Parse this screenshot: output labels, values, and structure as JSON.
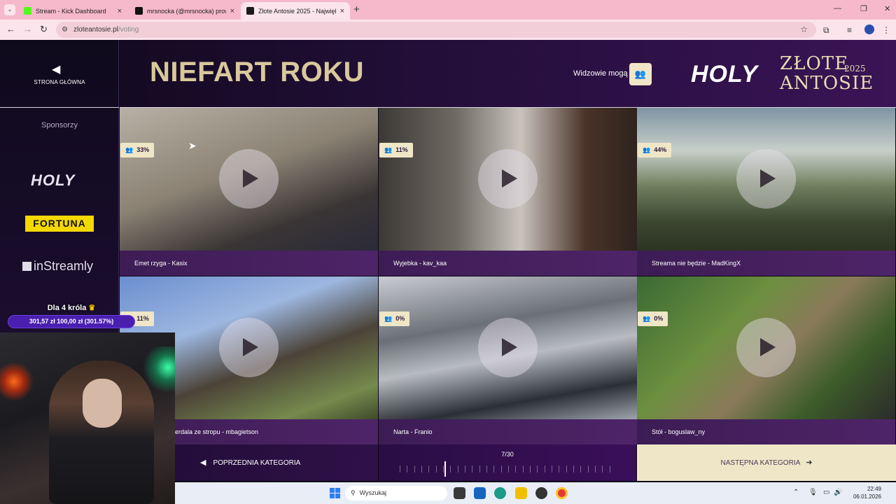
{
  "browser": {
    "tabs": [
      {
        "title": "Stream - Kick Dashboard",
        "favicon_color": "#53fc18",
        "active": false
      },
      {
        "title": "mrsnocka (@mrsnocka) prowad",
        "favicon_color": "#111111",
        "active": false
      },
      {
        "title": "Złote Antosie 2025 - Najwięks",
        "favicon_color": "#1a1a1a",
        "active": true
      }
    ],
    "url_host": "zloteantosie.pl",
    "url_path": "/voting"
  },
  "sidebar": {
    "home_label": "STRONA GŁÓWNA",
    "sponsors_heading": "Sponsorzy",
    "sponsors": [
      "HOLY",
      "FORTUNA",
      "inStreamly"
    ]
  },
  "header": {
    "category_title": "NIEFART ROKU",
    "viewers_label": "Widzowie mogą",
    "brand_logo": "HOLY",
    "event_logo_line1": "ZŁOTE",
    "event_logo_line2": "ANTOSIE",
    "event_year": "2025"
  },
  "clips": [
    {
      "title": "Emet rzyga - Kasix",
      "percent": "33%"
    },
    {
      "title": "Wyjebka - kav_kaa",
      "percent": "11%"
    },
    {
      "title": "Streama nie będzie - MadKingX",
      "percent": "44%"
    },
    {
      "title": "erdala ze stropu - mbagietson",
      "percent": "11%"
    },
    {
      "title": "Narta - Franio",
      "percent": "0%"
    },
    {
      "title": "Stół - boguslaw_ny",
      "percent": "0%"
    }
  ],
  "navigation": {
    "prev_label": "POPRZEDNIA KATEGORIA",
    "next_label": "NASTĘPNA KATEGORIA",
    "counter": "7/30",
    "progress": {
      "current": 7,
      "total": 30
    }
  },
  "overlay": {
    "goal_label": "Dla 4 króla",
    "goal_amounts": "301,57 zł   100,00 zł (301.57%)"
  },
  "taskbar": {
    "search_placeholder": "Wyszukaj",
    "time": "22:49",
    "date": "06.01.2026"
  },
  "colors": {
    "accent_gold": "#efe6c8",
    "title_gold": "#d8c89c",
    "caption_purple": "#4e2468",
    "donation_purple": "#4a1fb0"
  }
}
